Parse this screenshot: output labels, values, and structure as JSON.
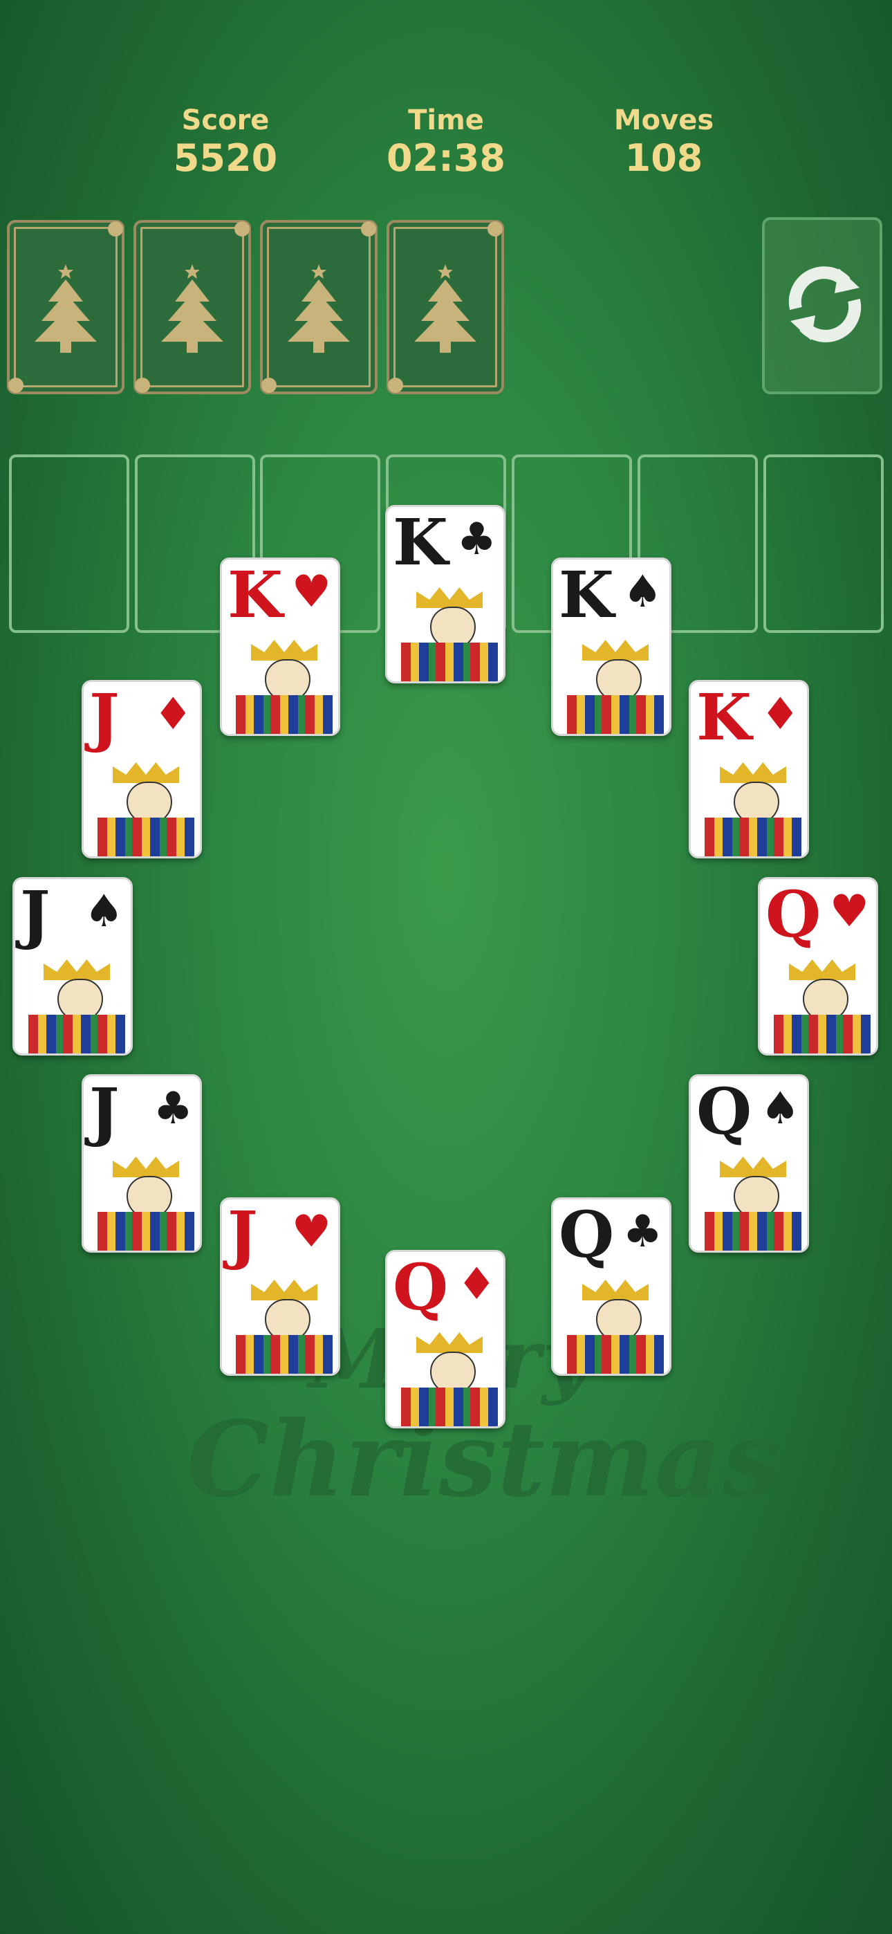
{
  "hud": {
    "score_label": "Score",
    "score_value": "5520",
    "time_label": "Time",
    "time_value": "02:38",
    "moves_label": "Moves",
    "moves_value": "108"
  },
  "deck": {
    "card_back_icon": "christmas-tree-icon",
    "count_shown": 4
  },
  "refresh": {
    "icon": "refresh-arrows-icon"
  },
  "foundation_slots": 7,
  "cards": [
    {
      "rank": "K",
      "suit": "♣",
      "color": "black"
    },
    {
      "rank": "K",
      "suit": "♥",
      "color": "red"
    },
    {
      "rank": "K",
      "suit": "♠",
      "color": "black"
    },
    {
      "rank": "J",
      "suit": "♦",
      "color": "red"
    },
    {
      "rank": "K",
      "suit": "♦",
      "color": "red"
    },
    {
      "rank": "J",
      "suit": "♠",
      "color": "black"
    },
    {
      "rank": "Q",
      "suit": "♥",
      "color": "red"
    },
    {
      "rank": "J",
      "suit": "♣",
      "color": "black"
    },
    {
      "rank": "Q",
      "suit": "♠",
      "color": "black"
    },
    {
      "rank": "J",
      "suit": "♥",
      "color": "red"
    },
    {
      "rank": "Q",
      "suit": "♣",
      "color": "black"
    },
    {
      "rank": "Q",
      "suit": "♦",
      "color": "red"
    }
  ],
  "watermark": {
    "line1": "Merry",
    "line2": "Christmas"
  },
  "colors": {
    "felt": "#2b8340",
    "gold_text": "#f0d98a",
    "red_suit": "#d0141d"
  }
}
